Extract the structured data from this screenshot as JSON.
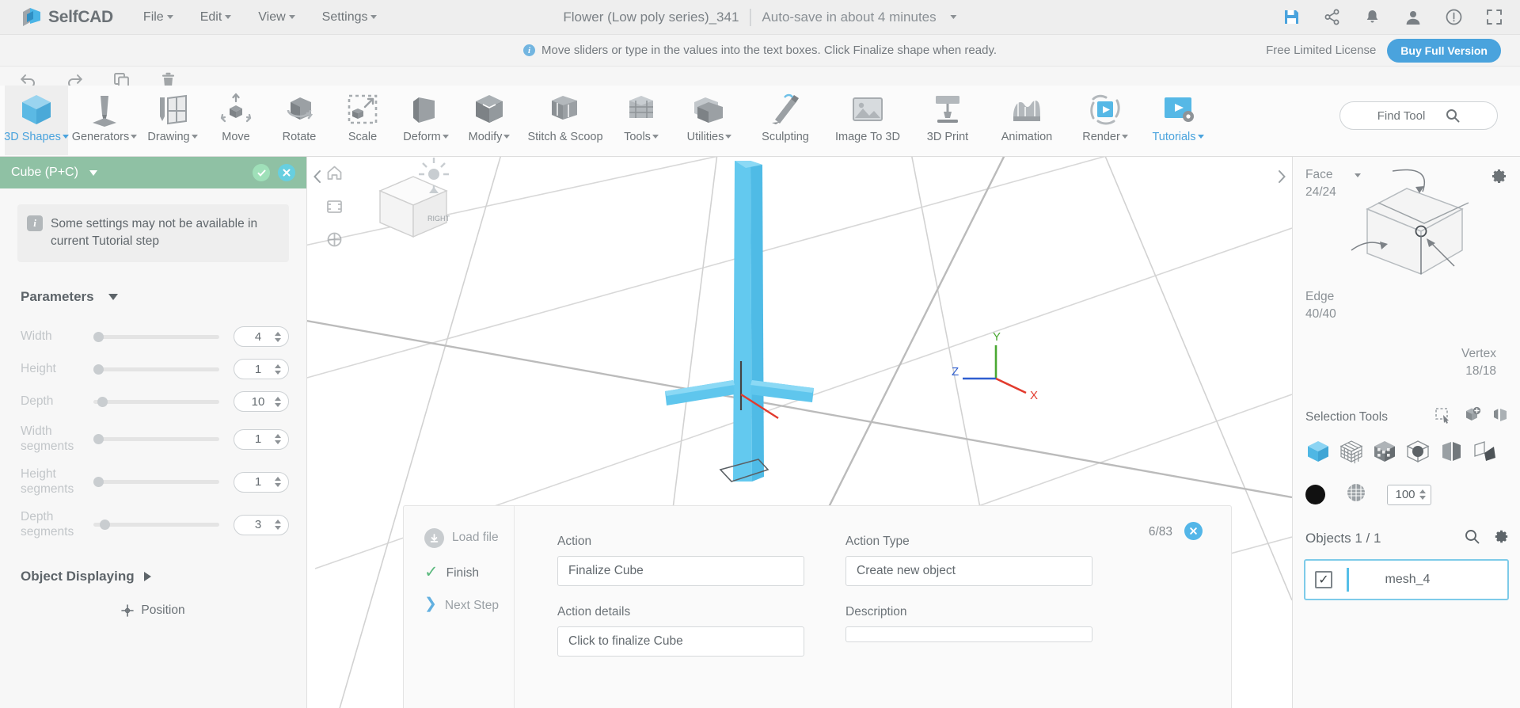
{
  "app": {
    "brand": "SelfCAD"
  },
  "menubar": {
    "items": [
      {
        "label": "File",
        "caret": true
      },
      {
        "label": "Edit",
        "caret": true
      },
      {
        "label": "View",
        "caret": true
      },
      {
        "label": "Settings",
        "caret": true
      }
    ],
    "doc_title": "Flower (Low poly series)_341",
    "autosave": "Auto-save in about 4 minutes",
    "right_icons": [
      "save-icon",
      "share-icon",
      "notifications-icon",
      "account-icon",
      "help-icon",
      "fullscreen-icon"
    ]
  },
  "notification": {
    "icon": "info-icon",
    "text": "Move sliders or type in the values into the text boxes. Click Finalize shape when ready.",
    "license": "Free Limited License",
    "buy_label": "Buy Full Version"
  },
  "actionrow": {
    "icons": [
      "undo-icon",
      "redo-icon",
      "copy-icon",
      "delete-icon"
    ]
  },
  "toolbar": {
    "tools": [
      {
        "label": "3D Shapes",
        "icon": "cube-icon",
        "caret": true,
        "active": true,
        "highlight": true
      },
      {
        "label": "Generators",
        "icon": "generator-icon",
        "caret": true
      },
      {
        "label": "Drawing",
        "icon": "drawing-icon",
        "caret": true
      },
      {
        "label": "Move",
        "icon": "move-icon",
        "caret": false
      },
      {
        "label": "Rotate",
        "icon": "rotate-icon",
        "caret": false
      },
      {
        "label": "Scale",
        "icon": "scale-icon",
        "caret": false
      },
      {
        "label": "Deform",
        "icon": "deform-icon",
        "caret": true
      },
      {
        "label": "Modify",
        "icon": "modify-icon",
        "caret": true
      },
      {
        "label": "Stitch & Scoop",
        "icon": "stitch-icon",
        "caret": false
      },
      {
        "label": "Tools",
        "icon": "tools-icon",
        "caret": true
      },
      {
        "label": "Utilities",
        "icon": "utilities-icon",
        "caret": true
      },
      {
        "label": "Sculpting",
        "icon": "sculpting-icon",
        "caret": false
      },
      {
        "label": "Image To 3D",
        "icon": "image-to-3d-icon",
        "caret": false
      },
      {
        "label": "3D Print",
        "icon": "3d-print-icon",
        "caret": false
      },
      {
        "label": "Animation",
        "icon": "animation-icon",
        "caret": false
      },
      {
        "label": "Render",
        "icon": "render-icon",
        "caret": true
      },
      {
        "label": "Tutorials",
        "icon": "tutorials-icon",
        "caret": true,
        "highlight": true
      }
    ],
    "find_tool": "Find Tool",
    "find_icon": "search-icon"
  },
  "left_panel": {
    "header_title": "Cube (P+C)",
    "confirm_icon": "check-icon",
    "cancel_icon": "close-icon",
    "note": "Some settings may not be available in current Tutorial step",
    "section_title": "Parameters",
    "parameters": [
      {
        "label": "Width",
        "value": "4",
        "knob_pct": 0
      },
      {
        "label": "Height",
        "value": "1",
        "knob_pct": 0
      },
      {
        "label": "Depth",
        "value": "10",
        "knob_pct": 3
      },
      {
        "label": "Width segments",
        "value": "1",
        "knob_pct": 0
      },
      {
        "label": "Height segments",
        "value": "1",
        "knob_pct": 0
      },
      {
        "label": "Depth segments",
        "value": "3",
        "knob_pct": 5
      }
    ],
    "object_displaying": "Object Displaying",
    "position_label": "Position",
    "position_icon": "position-icon"
  },
  "viewport": {
    "left_arrow": "chevron-left-icon",
    "right_arrow": "chevron-right-icon",
    "tools": [
      "home-icon",
      "camera-icon",
      "grid-snap-icon"
    ],
    "gizmo_labels": [
      "X",
      "Y",
      "Z"
    ],
    "view_cube_label": "RIGHT"
  },
  "tutorial": {
    "steps": [
      {
        "label": "Load file",
        "icon": "download-icon",
        "state": "pending"
      },
      {
        "label": "Finish",
        "icon": "check-icon",
        "state": "done"
      },
      {
        "label": "Next Step",
        "icon": "chevron-right-icon",
        "state": "next"
      }
    ],
    "action_label": "Action",
    "action_value": "Finalize Cube",
    "action_details_label": "Action details",
    "action_details_value": "Click to finalize Cube",
    "action_type_label": "Action Type",
    "action_type_value": "Create new object",
    "description_label": "Description",
    "description_value": "",
    "counter": "6/83",
    "close_icon": "close-icon"
  },
  "right_panel": {
    "face_label": "Face",
    "face_count": "24/24",
    "edge_label": "Edge",
    "edge_count": "40/40",
    "vertex_label": "Vertex",
    "vertex_count": "18/18",
    "gear_icon": "gear-icon",
    "selection_tools_label": "Selection Tools",
    "selection_icons": [
      "rect-select-icon",
      "add-select-icon",
      "invert-select-icon"
    ],
    "mode_icons": [
      "object-mode-icon",
      "wireframe-mode-icon",
      "face-mode-icon",
      "vertex-mode-icon",
      "edge-mode-icon",
      "polygon-mode-icon"
    ],
    "material_color": "#111111",
    "texture_icon": "texture-icon",
    "opacity_value": "100",
    "objects_label": "Objects 1 / 1",
    "objects_search_icon": "search-icon",
    "objects_gear_icon": "gear-icon",
    "objects": [
      {
        "name": "mesh_4",
        "checked": true,
        "selected": true
      }
    ]
  },
  "colors": {
    "accent": "#4aa3dd",
    "panel_header": "#8fc1a4",
    "selection": "#7ecbe9",
    "mesh": "#5ec8ef"
  }
}
